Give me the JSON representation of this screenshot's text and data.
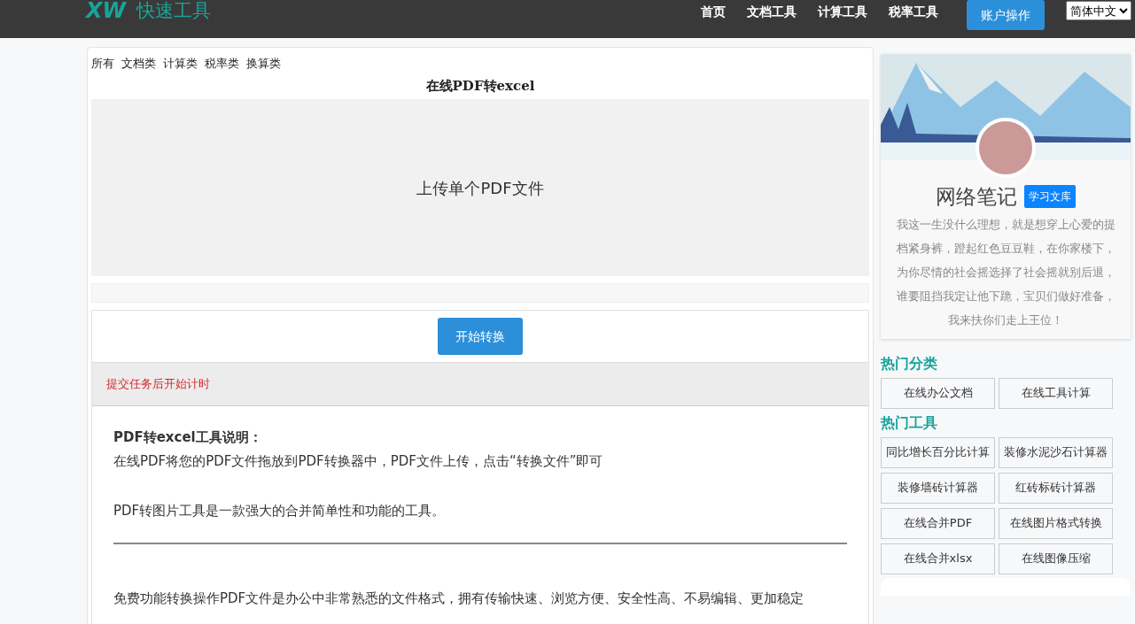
{
  "header": {
    "logo_mark": "XW",
    "logo_text": "快速工具",
    "nav": [
      {
        "label": "首页"
      },
      {
        "label": "文档工具"
      },
      {
        "label": "计算工具"
      },
      {
        "label": "税率工具"
      }
    ],
    "account_button": "账户操作",
    "language": "简体中文"
  },
  "categories": [
    {
      "label": "所有"
    },
    {
      "label": "文档类"
    },
    {
      "label": "计算类"
    },
    {
      "label": "税率类"
    },
    {
      "label": "换算类"
    }
  ],
  "tool": {
    "title": "在线PDF转excel",
    "upload_label": "上传单个PDF文件",
    "start_button": "开始转换",
    "timer_note": "提交任务后开始计时"
  },
  "description": {
    "heading": "PDF转excel工具说明：",
    "paragraphs": [
      "在线PDF将您的PDF文件拖放到PDF转换器中，PDF文件上传，点击“转换文件”即可",
      "PDF转图片工具是一款强大的合并简单性和功能的工具。"
    ],
    "after_rule": "免费功能转换操作PDF文件是办公中非常熟悉的文件格式，拥有传输快速、浏览方便、安全性高、不易编辑、更加稳定"
  },
  "profile": {
    "name": "网络笔记",
    "badge": "学习文库",
    "bio": "我这一生没什么理想，就是想穿上心爱的提档紧身裤，蹬起红色豆豆鞋，在你家楼下，为你尽情的社会摇选择了社会摇就别后退，谁要阻挡我定让他下跪，宝贝们做好准备，我来扶你们走上王位！"
  },
  "hot_categories": {
    "title": "热门分类",
    "items": [
      "在线办公文档",
      "在线工具计算"
    ]
  },
  "hot_tools": {
    "title": "热门工具",
    "items": [
      "同比增长百分比计算",
      "装修水泥沙石计算器",
      "装修墙砖计算器",
      "红砖标砖计算器",
      "在线合并PDF",
      "在线图片格式转换",
      "在线合并xlsx",
      "在线图像压缩"
    ]
  }
}
